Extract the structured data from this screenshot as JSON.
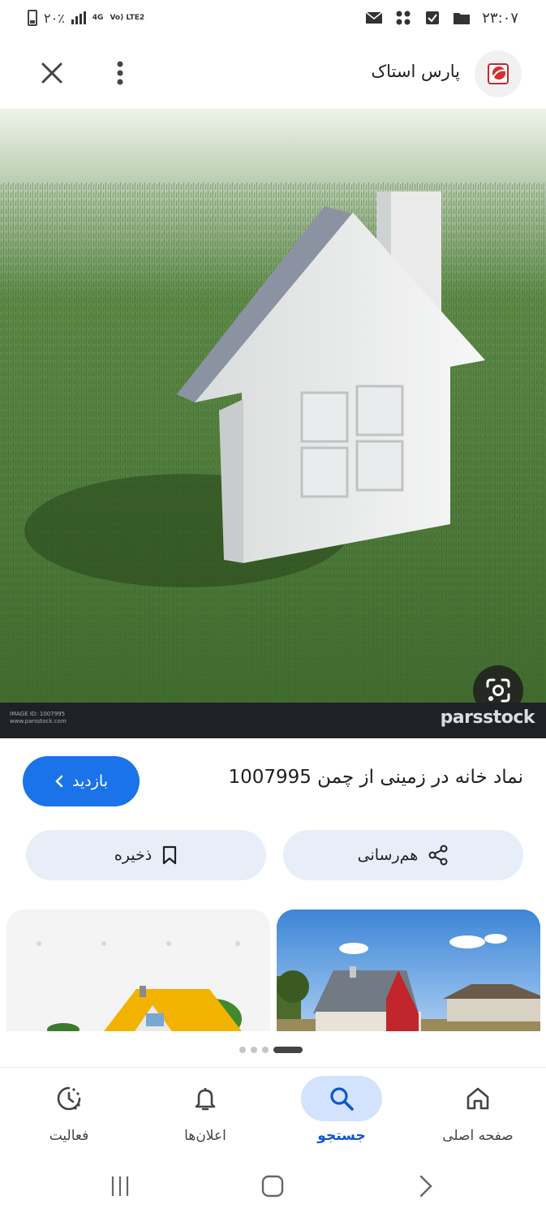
{
  "status_bar": {
    "time": "۲۳:۰۷",
    "battery": "۲۰٪",
    "network_top": "4G",
    "network_bottom": "Vo) LTE2"
  },
  "header": {
    "site_title": "پارس استاک"
  },
  "image": {
    "watermark_brand": "parsstock",
    "watermark_small_1": "IMAGE ID: 1007995",
    "watermark_small_2": "www.parsstock.com"
  },
  "details": {
    "caption": "نماد خانه در زمینی از چمن 1007995",
    "visit_label": "بازدید",
    "share_label": "هم‌رسانی",
    "save_label": "ذخیره"
  },
  "carousel": {
    "pages": 4,
    "active_page": 4
  },
  "bottom_nav": {
    "items": [
      {
        "label": "صفحه اصلی",
        "icon": "home-icon"
      },
      {
        "label": "جستجو",
        "icon": "search-icon"
      },
      {
        "label": "اعلان‌ها",
        "icon": "bell-icon"
      },
      {
        "label": "فعالیت",
        "icon": "activity-icon"
      }
    ],
    "active": "جستجو"
  },
  "colors": {
    "accent": "#1a73e8",
    "pill_bg": "#e8eef8",
    "nav_active_bg": "#d3e3fd",
    "nav_active_text": "#0b57d0"
  }
}
